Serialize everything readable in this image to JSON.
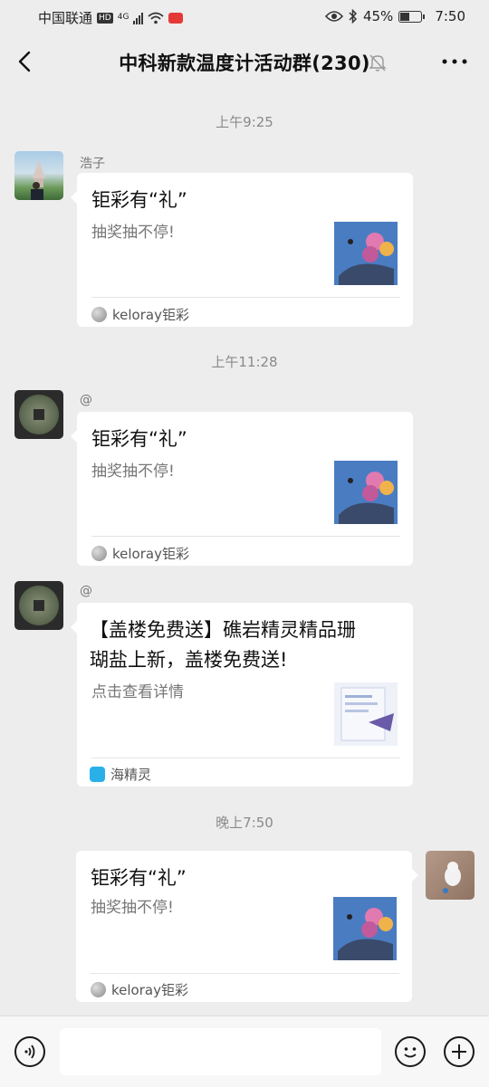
{
  "status_bar": {
    "carrier": "中国联通",
    "network_badge": "HD",
    "network_type": "4G",
    "battery": "45%",
    "time": "7:50"
  },
  "nav": {
    "title": "中科新款温度计活动群(230)",
    "back_icon": "chevron-left-icon",
    "mute_icon": "bell-off-icon",
    "more_icon": "more-dots-icon"
  },
  "messages": [
    {
      "time": "上午9:25",
      "sender": "浩子",
      "card": {
        "title": "钜彩有“礼”",
        "desc": "抽奖抽不停!",
        "source": "keloray钜彩"
      }
    },
    {
      "time": "上午11:28",
      "sender": "@",
      "card": {
        "title": "钜彩有“礼”",
        "desc": "抽奖抽不停!",
        "source": "keloray钜彩"
      }
    },
    {
      "sender": "@",
      "card": {
        "title_line1": "【盖楼免费送】礁岩精灵精品珊",
        "title_line2": "瑚盐上新，盖楼免费送!",
        "desc": "点击查看详情",
        "source": "海精灵"
      }
    },
    {
      "time": "晚上7:50",
      "card": {
        "title": "钜彩有“礼”",
        "desc": "抽奖抽不停!",
        "source": "keloray钜彩"
      }
    }
  ],
  "input_bar": {
    "voice_icon": "voice-icon",
    "emoji_icon": "emoji-icon",
    "add_icon": "plus-circle-icon",
    "placeholder": ""
  },
  "colors": {
    "background": "#ededed",
    "card": "#ffffff",
    "time_text": "#8a8a8a"
  }
}
